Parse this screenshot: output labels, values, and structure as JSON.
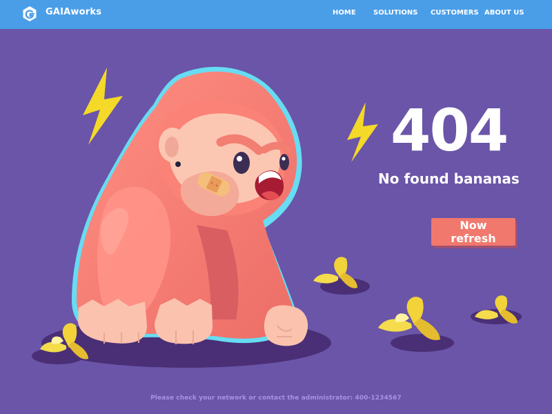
{
  "header": {
    "brand": "GAIAworks",
    "nav": [
      {
        "label": "HOME"
      },
      {
        "label": "SOLUTIONS"
      },
      {
        "label": "CUSTOMERS"
      },
      {
        "label": "ABOUT US"
      }
    ]
  },
  "main": {
    "error_code": "404",
    "message": "No found bananas",
    "refresh_label": "Now refresh"
  },
  "footer": {
    "text": "Please check your network or contact the administrator: 400-1234567"
  },
  "colors": {
    "header": "#4a9ee8",
    "background": "#6a55a8",
    "button": "#f1786d",
    "footer_text": "#a892e8",
    "gorilla": "#f47e73",
    "banana": "#f2d33a",
    "lightning": "#f4d928"
  },
  "icons": {
    "logo": "hexagon-g-icon",
    "lightning": "lightning-icon",
    "banana": "banana-peel-icon"
  }
}
